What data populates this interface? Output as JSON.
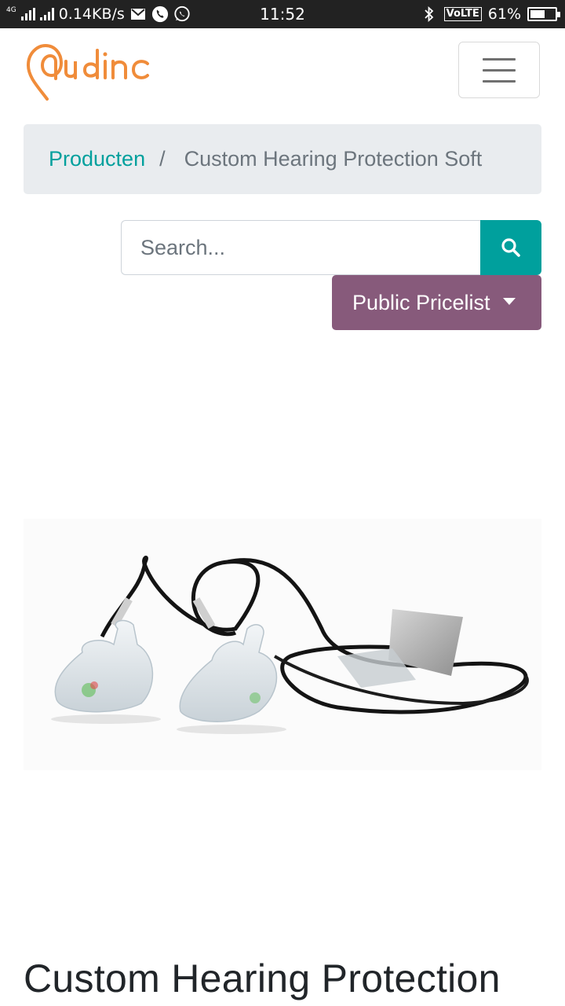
{
  "status_bar": {
    "network": "4G",
    "speed": "0.14KB/s",
    "time": "11:52",
    "volte": "VoLTE",
    "battery_percent_text": "61%",
    "battery_level": 0.61
  },
  "header": {
    "logo_text": "Audinc",
    "menu_icon": "hamburger-icon"
  },
  "breadcrumb": {
    "parent": "Producten",
    "separator": "/",
    "current": "Custom Hearing Protection Soft"
  },
  "search": {
    "placeholder": "Search...",
    "value": "",
    "button_icon": "search-icon"
  },
  "pricelist": {
    "label": "Public Pricelist"
  },
  "product": {
    "title": "Custom Hearing Protection"
  },
  "colors": {
    "brand_orange": "#f08c3a",
    "primary_teal": "#00a09d",
    "pricelist_purple": "#875a7b",
    "breadcrumb_bg": "#e9ecef",
    "muted_text": "#6c757d"
  }
}
